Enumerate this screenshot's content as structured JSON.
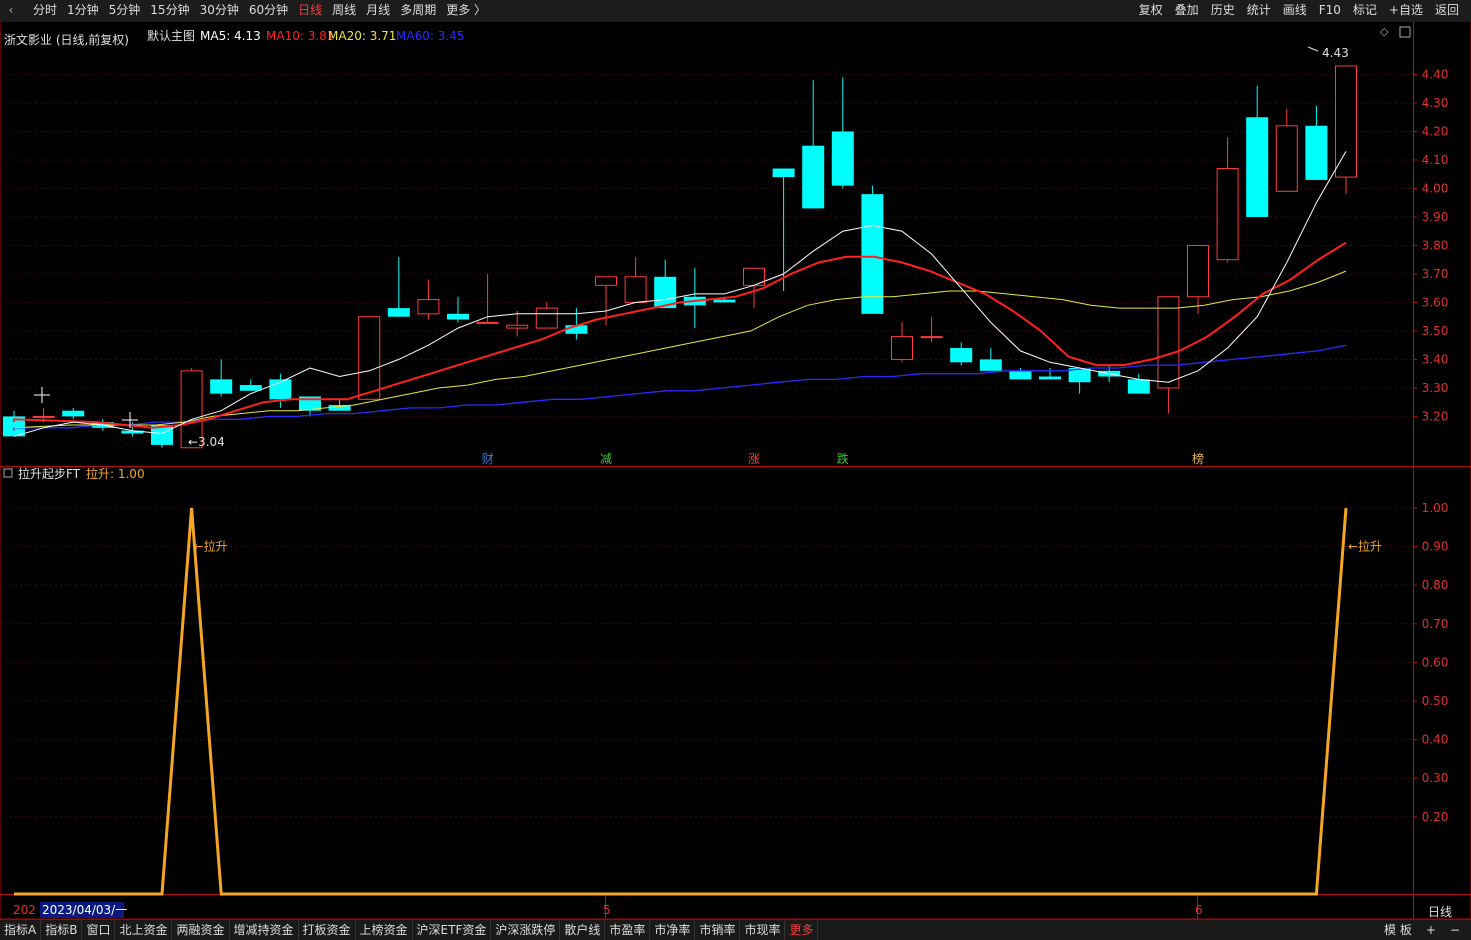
{
  "toolbar": {
    "back_icon": "‹",
    "periods": [
      "分时",
      "1分钟",
      "5分钟",
      "15分钟",
      "30分钟",
      "60分钟",
      "日线",
      "周线",
      "月线",
      "多周期",
      "更多 〉"
    ],
    "active_period": "日线",
    "right_tools": [
      "复权",
      "叠加",
      "历史",
      "统计",
      "画线",
      "F10",
      "标记",
      "+自选",
      "返回"
    ]
  },
  "main_panel": {
    "title": "浙文影业 (日线,前复权)",
    "indicator_name": "默认主图",
    "ma_labels": [
      {
        "text": "MA5: 4.13",
        "color": "#ffffff"
      },
      {
        "text": "MA10: 3.81",
        "color": "#ff2020"
      },
      {
        "text": "MA20: 3.71",
        "color": "#e8e840"
      },
      {
        "text": "MA60: 3.45",
        "color": "#2a2aff"
      }
    ],
    "high_label": "4.43",
    "low_label": "←3.04",
    "events": [
      {
        "text": "财",
        "color": "#3a7bd5",
        "index": 16
      },
      {
        "text": "减",
        "color": "#3ac23a",
        "index": 20
      },
      {
        "text": "涨",
        "color": "#ff3b3b",
        "index": 25
      },
      {
        "text": "跌",
        "color": "#3ac23a",
        "index": 28
      },
      {
        "text": "榜",
        "color": "#e8b040",
        "index": 40
      }
    ],
    "corner_icons": [
      "diamond-icon",
      "expand-icon"
    ]
  },
  "sub_panel": {
    "title": "拉升起步FT",
    "value_label": "拉升: 1.00",
    "annotation": "←拉升"
  },
  "xaxis": {
    "labels": [
      {
        "text": "202",
        "index": 0
      },
      {
        "text": "5",
        "index": 20
      },
      {
        "text": "6",
        "index": 40
      }
    ],
    "cursor_date": "2023/04/03/一",
    "period_label": "日线"
  },
  "bottom_tabs": [
    "指标A",
    "指标B",
    "窗口",
    "北上资金",
    "两融资金",
    "增减持资金",
    "打板资金",
    "上榜资金",
    "沪深ETF资金",
    "沪深涨跌停",
    "散户线",
    "市盈率",
    "市净率",
    "市销率",
    "市现率",
    "更多"
  ],
  "bottom_right": [
    "模 板",
    "+",
    "−"
  ],
  "colors": {
    "up": "#ff3b3b",
    "down": "#00ffff",
    "ma5": "#ffffff",
    "ma10": "#ff2020",
    "ma20": "#e8e840",
    "ma60": "#2a2aff",
    "signal": "#f5a623",
    "axis": "#b01010",
    "grid": "#3a0a0a"
  },
  "chart_data": [
    {
      "type": "candlestick",
      "title": "浙文影业 (日线,前复权)",
      "ylim": [
        3.04,
        4.43
      ],
      "yticks": [
        3.2,
        3.3,
        3.4,
        3.5,
        3.6,
        3.7,
        3.8,
        3.9,
        4.0,
        4.1,
        4.2,
        4.3,
        4.4
      ],
      "ohlc": [
        [
          3.2,
          3.22,
          3.14,
          3.13
        ],
        [
          3.2,
          3.23,
          3.18,
          3.2
        ],
        [
          3.22,
          3.23,
          3.19,
          3.2
        ],
        [
          3.18,
          3.19,
          3.15,
          3.16
        ],
        [
          3.15,
          3.18,
          3.13,
          3.14
        ],
        [
          3.17,
          3.17,
          3.09,
          3.1
        ],
        [
          3.09,
          3.37,
          3.09,
          3.36
        ],
        [
          3.33,
          3.4,
          3.27,
          3.28
        ],
        [
          3.31,
          3.33,
          3.3,
          3.29
        ],
        [
          3.33,
          3.35,
          3.23,
          3.26
        ],
        [
          3.27,
          3.27,
          3.2,
          3.22
        ],
        [
          3.24,
          3.26,
          3.22,
          3.22
        ],
        [
          3.26,
          3.55,
          3.26,
          3.55
        ],
        [
          3.58,
          3.76,
          3.55,
          3.55
        ],
        [
          3.56,
          3.68,
          3.54,
          3.61
        ],
        [
          3.56,
          3.62,
          3.53,
          3.54
        ],
        [
          3.53,
          3.7,
          3.53,
          3.53
        ],
        [
          3.51,
          3.57,
          3.48,
          3.52
        ],
        [
          3.51,
          3.6,
          3.51,
          3.58
        ],
        [
          3.52,
          3.58,
          3.47,
          3.49
        ],
        [
          3.66,
          3.67,
          3.52,
          3.69
        ],
        [
          3.6,
          3.76,
          3.6,
          3.69
        ],
        [
          3.69,
          3.75,
          3.6,
          3.58
        ],
        [
          3.62,
          3.72,
          3.51,
          3.59
        ],
        [
          3.61,
          3.62,
          3.6,
          3.6
        ],
        [
          3.66,
          3.68,
          3.58,
          3.72
        ],
        [
          4.07,
          4.07,
          3.64,
          4.04
        ],
        [
          4.15,
          4.38,
          3.93,
          3.93
        ],
        [
          4.2,
          4.39,
          4.0,
          4.01
        ],
        [
          3.98,
          4.01,
          3.64,
          3.56
        ],
        [
          3.4,
          3.53,
          3.39,
          3.48
        ],
        [
          3.48,
          3.55,
          3.46,
          3.48
        ],
        [
          3.44,
          3.46,
          3.38,
          3.39
        ],
        [
          3.4,
          3.44,
          3.38,
          3.36
        ],
        [
          3.36,
          3.37,
          3.33,
          3.33
        ],
        [
          3.34,
          3.37,
          3.33,
          3.33
        ],
        [
          3.37,
          3.37,
          3.28,
          3.32
        ],
        [
          3.36,
          3.38,
          3.32,
          3.34
        ],
        [
          3.33,
          3.35,
          3.28,
          3.28
        ],
        [
          3.3,
          3.62,
          3.21,
          3.62
        ],
        [
          3.62,
          3.8,
          3.56,
          3.8
        ],
        [
          3.75,
          4.18,
          3.74,
          4.07
        ],
        [
          4.25,
          4.36,
          3.9,
          3.9
        ],
        [
          3.99,
          4.28,
          3.99,
          4.22
        ],
        [
          4.22,
          4.29,
          4.03,
          4.03
        ],
        [
          4.04,
          4.43,
          3.98,
          4.43
        ]
      ],
      "ma5": [
        3.13,
        3.16,
        3.18,
        3.17,
        3.15,
        3.14,
        3.19,
        3.22,
        3.28,
        3.32,
        3.37,
        3.34,
        3.36,
        3.4,
        3.45,
        3.51,
        3.55,
        3.56,
        3.56,
        3.56,
        3.57,
        3.6,
        3.61,
        3.63,
        3.63,
        3.66,
        3.7,
        3.78,
        3.85,
        3.87,
        3.85,
        3.77,
        3.65,
        3.53,
        3.43,
        3.39,
        3.37,
        3.35,
        3.33,
        3.32,
        3.36,
        3.44,
        3.55,
        3.74,
        3.95,
        4.13
      ],
      "ma10": [
        3.18,
        3.19,
        3.19,
        3.18,
        3.17,
        3.16,
        3.17,
        3.19,
        3.22,
        3.25,
        3.26,
        3.26,
        3.26,
        3.29,
        3.32,
        3.35,
        3.38,
        3.41,
        3.44,
        3.47,
        3.51,
        3.54,
        3.56,
        3.58,
        3.6,
        3.61,
        3.62,
        3.65,
        3.7,
        3.74,
        3.76,
        3.76,
        3.74,
        3.71,
        3.67,
        3.63,
        3.57,
        3.5,
        3.41,
        3.38,
        3.38,
        3.4,
        3.43,
        3.48,
        3.55,
        3.63,
        3.68,
        3.75,
        3.81
      ],
      "ma20": [
        3.16,
        3.16,
        3.17,
        3.17,
        3.17,
        3.17,
        3.18,
        3.2,
        3.21,
        3.22,
        3.22,
        3.23,
        3.24,
        3.26,
        3.28,
        3.3,
        3.31,
        3.33,
        3.34,
        3.36,
        3.38,
        3.4,
        3.42,
        3.44,
        3.46,
        3.48,
        3.5,
        3.55,
        3.59,
        3.61,
        3.62,
        3.62,
        3.63,
        3.64,
        3.64,
        3.63,
        3.62,
        3.61,
        3.59,
        3.58,
        3.58,
        3.58,
        3.59,
        3.61,
        3.62,
        3.64,
        3.67,
        3.71
      ],
      "ma60": [
        3.15,
        3.16,
        3.16,
        3.17,
        3.17,
        3.18,
        3.18,
        3.19,
        3.19,
        3.2,
        3.2,
        3.21,
        3.21,
        3.22,
        3.23,
        3.23,
        3.24,
        3.24,
        3.25,
        3.26,
        3.26,
        3.27,
        3.28,
        3.29,
        3.29,
        3.3,
        3.31,
        3.32,
        3.33,
        3.33,
        3.34,
        3.34,
        3.35,
        3.35,
        3.35,
        3.36,
        3.36,
        3.36,
        3.37,
        3.37,
        3.38,
        3.38,
        3.39,
        3.4,
        3.41,
        3.42,
        3.43,
        3.45
      ]
    },
    {
      "type": "line",
      "title": "拉升起步FT",
      "ylim": [
        0,
        1.0
      ],
      "yticks": [
        0.2,
        0.3,
        0.4,
        0.5,
        0.6,
        0.7,
        0.8,
        0.9,
        1.0
      ],
      "series": [
        {
          "name": "拉升",
          "values": [
            0,
            0,
            0,
            0,
            0,
            0,
            1,
            0,
            0,
            0,
            0,
            0,
            0,
            0,
            0,
            0,
            0,
            0,
            0,
            0,
            0,
            0,
            0,
            0,
            0,
            0,
            0,
            0,
            0,
            0,
            0,
            0,
            0,
            0,
            0,
            0,
            0,
            0,
            0,
            0,
            0,
            0,
            0,
            0,
            0,
            1
          ]
        }
      ]
    }
  ]
}
